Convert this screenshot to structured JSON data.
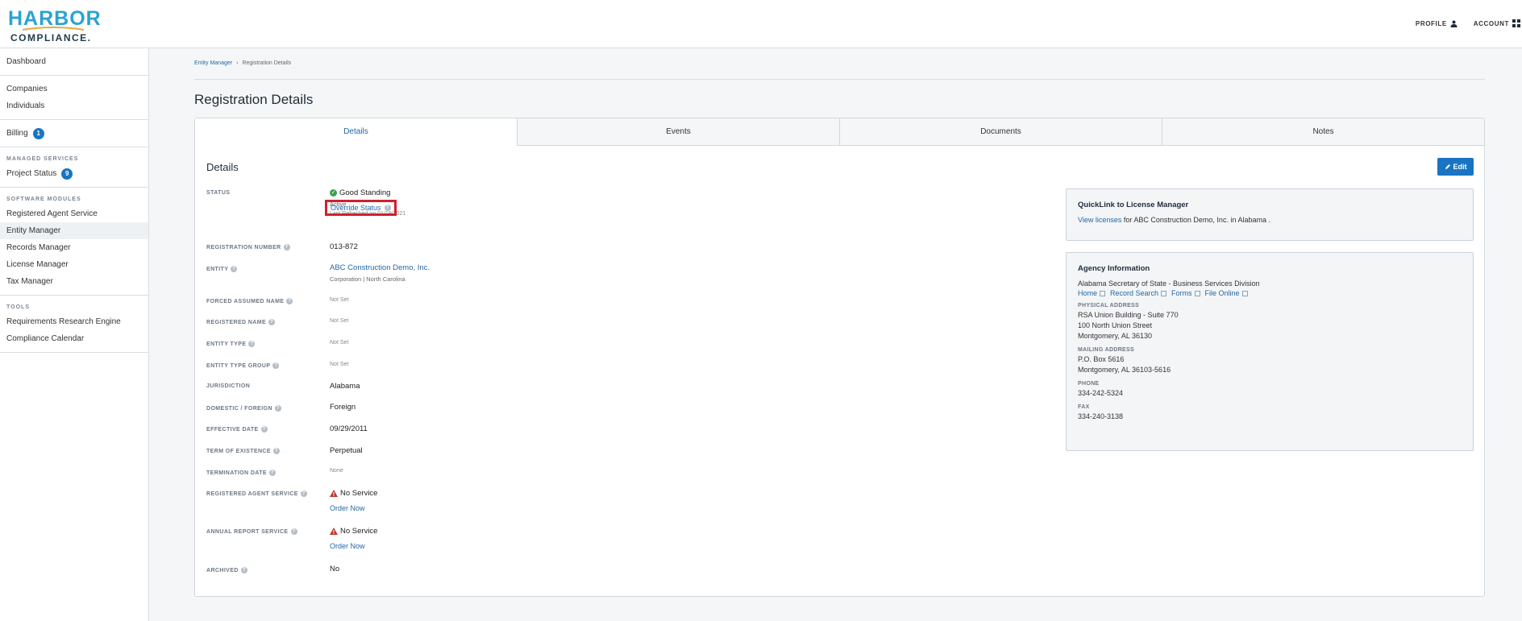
{
  "brand": {
    "name_top": "HARBOR",
    "name_bottom": "COMPLIANCE",
    "name_bottom_suffix": "."
  },
  "topnav": {
    "profile": "PROFILE",
    "account": "ACCOUNT"
  },
  "sidebar": {
    "dashboard": "Dashboard",
    "companies": "Companies",
    "individuals": "Individuals",
    "billing": "Billing",
    "billing_badge": "1",
    "managed_services_label": "MANAGED SERVICES",
    "project_status": "Project Status",
    "project_status_badge": "9",
    "software_modules_label": "SOFTWARE MODULES",
    "registered_agent_service": "Registered Agent Service",
    "entity_manager": "Entity Manager",
    "records_manager": "Records Manager",
    "license_manager": "License Manager",
    "tax_manager": "Tax Manager",
    "tools_label": "TOOLS",
    "requirements_research_engine": "Requirements Research Engine",
    "compliance_calendar": "Compliance Calendar"
  },
  "breadcrumb": {
    "parent": "Entity Manager",
    "separator": "›",
    "current": "Registration Details"
  },
  "page_title": "Registration Details",
  "tabs": [
    "Details",
    "Events",
    "Documents",
    "Notes"
  ],
  "details": {
    "title": "Details",
    "edit_label": "Edit",
    "status": {
      "label": "STATUS",
      "value": "Good Standing",
      "sub": "Active",
      "refreshed": "Last Refreshed on 01/19/2021",
      "override": "Override Status"
    },
    "registration_number": {
      "label": "REGISTRATION NUMBER",
      "value": "013-872"
    },
    "entity": {
      "label": "ENTITY",
      "value": "ABC Construction Demo, Inc.",
      "sub": "Corporation | North Carolina"
    },
    "forced_assumed_name": {
      "label": "FORCED ASSUMED NAME",
      "value": "Not Set"
    },
    "registered_name": {
      "label": "REGISTERED NAME",
      "value": "Not Set"
    },
    "entity_type": {
      "label": "ENTITY TYPE",
      "value": "Not Set"
    },
    "entity_type_group": {
      "label": "ENTITY TYPE GROUP",
      "value": "Not Set"
    },
    "jurisdiction": {
      "label": "JURISDICTION",
      "value": "Alabama"
    },
    "domestic_foreign": {
      "label": "DOMESTIC / FOREIGN",
      "value": "Foreign"
    },
    "effective_date": {
      "label": "EFFECTIVE DATE",
      "value": "09/29/2011"
    },
    "term_of_existence": {
      "label": "TERM OF EXISTENCE",
      "value": "Perpetual"
    },
    "termination_date": {
      "label": "TERMINATION DATE",
      "value": "None"
    },
    "registered_agent_service": {
      "label": "REGISTERED AGENT SERVICE",
      "value": "No Service",
      "action": "Order Now"
    },
    "annual_report_service": {
      "label": "ANNUAL REPORT SERVICE",
      "value": "No Service",
      "action": "Order Now"
    },
    "archived": {
      "label": "ARCHIVED",
      "value": "No"
    }
  },
  "quicklink": {
    "title": "QuickLink to License Manager",
    "link": "View licenses",
    "text": "for ABC Construction Demo, Inc. in Alabama ."
  },
  "agency": {
    "title": "Agency Information",
    "name": "Alabama Secretary of State - Business Services Division",
    "links": [
      "Home",
      "Record Search",
      "Forms",
      "File Online"
    ],
    "physical_label": "PHYSICAL ADDRESS",
    "physical": [
      "RSA Union Building - Suite 770",
      "100 North Union Street",
      "Montgomery, AL 36130"
    ],
    "mailing_label": "MAILING ADDRESS",
    "mailing": [
      "P.O. Box 5616",
      "Montgomery, AL 36103-5616"
    ],
    "phone_label": "PHONE",
    "phone": "334-242-5324",
    "fax_label": "FAX",
    "fax": "334-240-3138"
  },
  "colors": {
    "accent": "#1a74c2",
    "brand": "#2aa3cf",
    "highlight": "#d0202e",
    "ok": "#3aa34a",
    "warn": "#c0392b"
  }
}
